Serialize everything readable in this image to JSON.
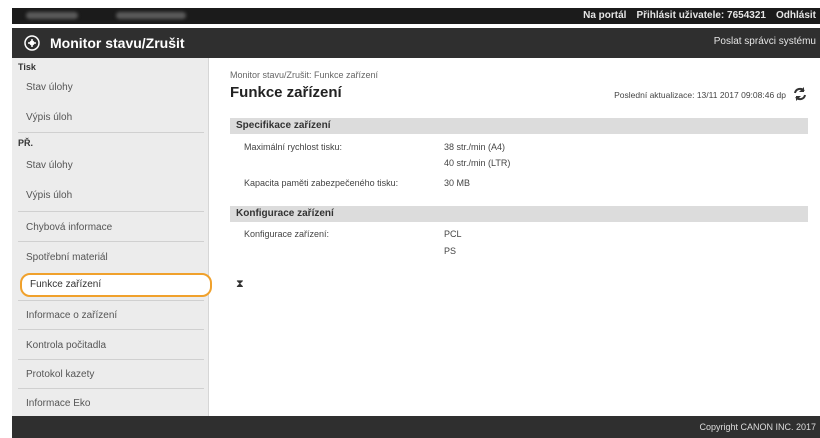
{
  "topbar": {
    "portal": "Na portál",
    "login_label": "Přihlásit uživatele:",
    "user_id": "7654321",
    "logout": "Odhlásit"
  },
  "header": {
    "title": "Monitor stavu/Zrušit",
    "send_mail": "Poslat správci systému"
  },
  "sidebar": {
    "print_head": "Tisk",
    "print_items": [
      "Stav úlohy",
      "Výpis úloh"
    ],
    "fax_head": "PŘ.",
    "fax_items": [
      "Stav úlohy",
      "Výpis úloh"
    ],
    "items": [
      "Chybová informace",
      "Spotřební materiál",
      "Funkce zařízení",
      "Informace o zařízení",
      "Kontrola počitadla",
      "Protokol kazety",
      "Informace Eko"
    ]
  },
  "main": {
    "breadcrumb": "Monitor stavu/Zrušit: Funkce zařízení",
    "title": "Funkce zařízení",
    "last_update": "Poslední aktualizace: 13/11 2017 09:08:46 dp",
    "spec_section": "Specifikace zařízení",
    "max_speed_label": "Maximální rychlost tisku:",
    "max_speed_a4": "38 str./min (A4)",
    "max_speed_ltr": "40 str./min (LTR)",
    "memory_label": "Kapacita paměti zabezpečeného tisku:",
    "memory_value": "30 MB",
    "config_section": "Konfigurace zařízení",
    "config_label": "Konfigurace zařízení:",
    "config_values": [
      "PCL",
      "PS"
    ],
    "top_anchor": "⧗"
  },
  "footer": {
    "copyright": "Copyright CANON INC. 2017"
  }
}
